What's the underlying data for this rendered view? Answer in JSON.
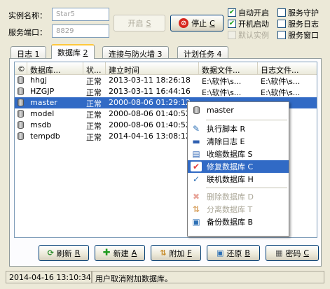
{
  "instance": {
    "name_label": "实例名称：",
    "name_value": "Star5",
    "port_label": "服务端口：",
    "port_value": "8829"
  },
  "controls": {
    "start_label": "开启",
    "start_key": "S",
    "stop_label": "停止",
    "stop_key": "C",
    "options": [
      {
        "label": "自动开启",
        "checked": true,
        "disabled": false
      },
      {
        "label": "服务守护",
        "checked": false,
        "disabled": false
      },
      {
        "label": "开机启动",
        "checked": true,
        "disabled": false
      },
      {
        "label": "服务日志",
        "checked": false,
        "disabled": false
      },
      {
        "label": "默认实例",
        "checked": false,
        "disabled": true
      },
      {
        "label": "服务窗口",
        "checked": false,
        "disabled": false
      }
    ]
  },
  "tabs": [
    {
      "label": "日志",
      "key": "1"
    },
    {
      "label": "数据库",
      "key": "2"
    },
    {
      "label": "连接与防火墙",
      "key": "3"
    },
    {
      "label": "计划任务",
      "key": "4"
    }
  ],
  "table": {
    "columns": [
      "©",
      "数据库...",
      "状...",
      "建立时间",
      "数据文件...",
      "日志文件..."
    ],
    "rows": [
      [
        "hhgj",
        "正常",
        "2013-03-11 18:26:18",
        "E:\\软件\\s...",
        "E:\\软件\\s..."
      ],
      [
        "HZGJP",
        "正常",
        "2013-03-11 16:44:16",
        "E:\\软件\\s...",
        "E:\\软件\\s..."
      ],
      [
        "master",
        "正常",
        "2000-08-06 01:29:12",
        "",
        ""
      ],
      [
        "model",
        "正常",
        "2000-08-06 01:40:52",
        "",
        ""
      ],
      [
        "msdb",
        "正常",
        "2000-08-06 01:40:52",
        "",
        ""
      ],
      [
        "tempdb",
        "正常",
        "2014-04-16 13:08:12",
        "",
        ""
      ]
    ]
  },
  "context_menu": {
    "header": "master",
    "items": [
      {
        "label": "执行脚本",
        "key": "R",
        "icon": "script-icon"
      },
      {
        "label": "清除日志",
        "key": "E",
        "icon": "clear-log-icon"
      },
      {
        "label": "收缩数据库",
        "key": "S",
        "icon": "shrink-icon"
      },
      {
        "label": "修复数据库",
        "key": "C",
        "icon": "repair-icon"
      },
      {
        "label": "联机数据库",
        "key": "H",
        "icon": "online-icon"
      },
      {
        "label": "删除数据库",
        "key": "D",
        "icon": "delete-icon"
      },
      {
        "label": "分离数据库",
        "key": "T",
        "icon": "detach-icon"
      },
      {
        "label": "备份数据库",
        "key": "B",
        "icon": "backup-icon"
      }
    ]
  },
  "buttons": {
    "refresh": {
      "label": "刷新",
      "key": "R"
    },
    "new": {
      "label": "新建",
      "key": "A"
    },
    "attach": {
      "label": "附加",
      "key": "F"
    },
    "restore": {
      "label": "还原",
      "key": "B"
    },
    "password": {
      "label": "密码",
      "key": "C"
    }
  },
  "status": {
    "time": "2014-04-16 13:10:34",
    "message": "用户取消附加数据库。"
  },
  "colors": {
    "selection": "#316ac5",
    "window_bg": "#ece9d8",
    "tab_accent": "#ffc83c"
  }
}
